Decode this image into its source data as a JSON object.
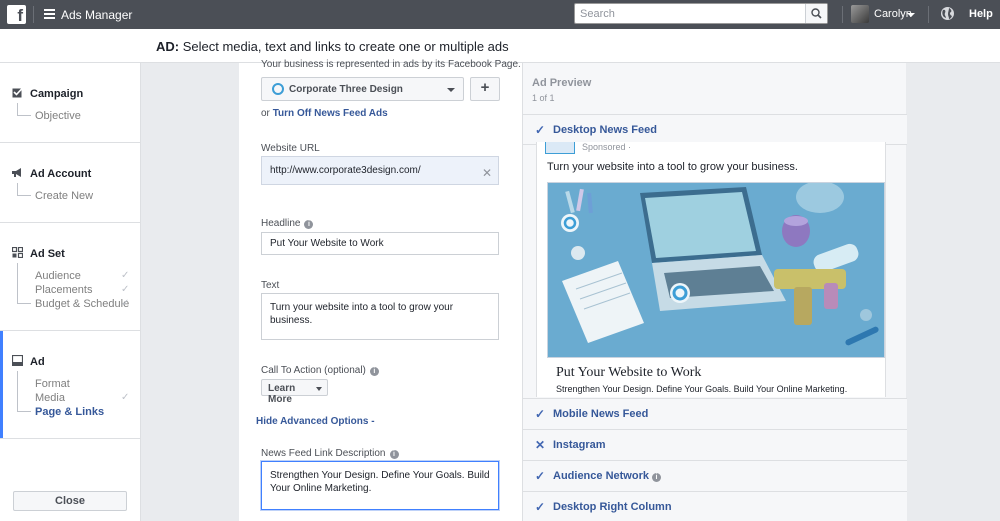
{
  "topbar": {
    "logo": "f",
    "app_title": "Ads Manager",
    "search_placeholder": "Search",
    "user_name": "Carolyn",
    "help_label": "Help",
    "icons": [
      "facebook-logo-icon",
      "hamburger-icon",
      "search-icon",
      "chevron-down-icon",
      "globe-icon"
    ]
  },
  "header": {
    "prefix": "AD:",
    "title": "Select media, text and links to create one or multiple ads"
  },
  "sidebar": {
    "sections": [
      {
        "label": "Campaign",
        "icon": "checkbox-icon",
        "items": [
          {
            "label": "Objective",
            "done": false
          }
        ]
      },
      {
        "label": "Ad Account",
        "icon": "megaphone-icon",
        "items": [
          {
            "label": "Create New",
            "done": false
          }
        ]
      },
      {
        "label": "Ad Set",
        "icon": "grid-icon",
        "items": [
          {
            "label": "Audience",
            "done": true
          },
          {
            "label": "Placements",
            "done": true
          },
          {
            "label": "Budget & Schedule",
            "done": true
          }
        ]
      },
      {
        "label": "Ad",
        "icon": "ad-window-icon",
        "items": [
          {
            "label": "Format",
            "done": false
          },
          {
            "label": "Media",
            "done": true
          },
          {
            "label": "Page & Links",
            "done": false,
            "active": true
          }
        ]
      }
    ],
    "close_label": "Close",
    "check_glyph": "✓"
  },
  "form": {
    "cut_text": "Your business is represented in ads by its Facebook Page.",
    "page_select": "Corporate Three Design",
    "add_label": "+",
    "turnoff_prefix": "or",
    "turnoff_link": "Turn Off News Feed Ads",
    "website_url_label": "Website URL",
    "website_url": "http://www.corporate3design.com/",
    "clear_glyph": "✕",
    "headline_label": "Headline",
    "headline": "Put Your Website to Work",
    "text_label": "Text",
    "text": "Turn your website into a tool to grow your business.",
    "cta_label": "Call To Action (optional)",
    "cta_value": "Learn More",
    "advanced_link": "Hide Advanced Options -",
    "desc_label": "News Feed Link Description",
    "desc": "Strengthen Your Design. Define Your Goals. Build Your Online Marketing.",
    "info_glyph": "i"
  },
  "preview": {
    "title": "Ad Preview",
    "count": "1 of 1",
    "placements": [
      {
        "label": "Desktop News Feed",
        "mark": "✓",
        "info": false
      },
      {
        "label": "Mobile News Feed",
        "mark": "✓",
        "info": false
      },
      {
        "label": "Instagram",
        "mark": "✕",
        "info": false
      },
      {
        "label": "Audience Network",
        "mark": "✓",
        "info": true
      },
      {
        "label": "Desktop Right Column",
        "mark": "✓",
        "info": false
      }
    ],
    "ad": {
      "sponsored": "Sponsored · ",
      "text": "Turn your website into a tool to grow your business.",
      "headline": "Put Your Website to Work",
      "description": "Strengthen Your Design. Define Your Goals. Build Your Online Marketing."
    }
  },
  "colors": {
    "topbar": "#4b4f56",
    "link": "#365899",
    "accent": "#4080ff",
    "image_tint": "#5fa3c8"
  }
}
